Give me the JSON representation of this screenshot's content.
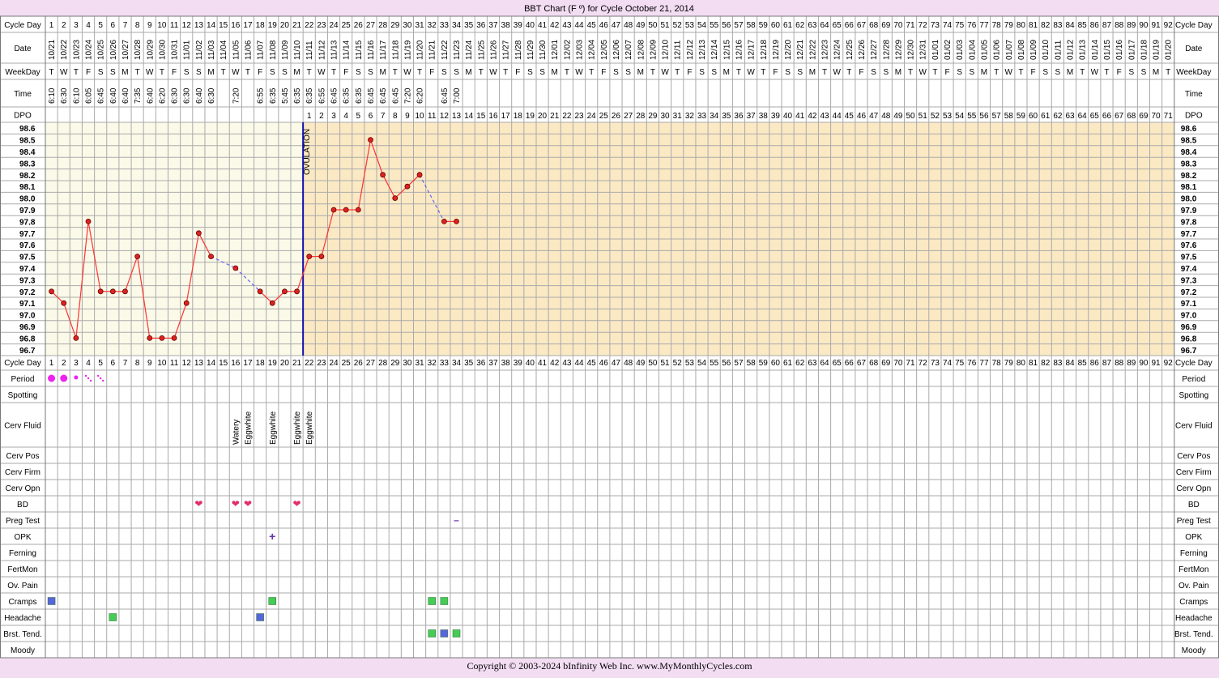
{
  "title": "BBT Chart (F º) for Cycle October 21, 2014",
  "copyright": "Copyright © 2003-2024 bInfinity Web Inc.     www.MyMonthlyCycles.com",
  "colors": {
    "page_bg": "#f3ddf3",
    "pre_ovulation_bg": "#fbf9e8",
    "post_ovulation_bg": "#fbe9c4",
    "grid": "#aaaaaa",
    "line": "#ff3333",
    "point": "#dd2222",
    "gap_line": "#6666ee",
    "ovulation_line": "#1111aa",
    "heart": "#e0306f",
    "period": "#ee22ee",
    "green_box": "#44cc55",
    "blue_box": "#5566dd"
  },
  "row_labels": {
    "cycle_day": "Cycle Day",
    "date": "Date",
    "weekday": "WeekDay",
    "time": "Time",
    "dpo": "DPO"
  },
  "ovulation_label": "OVULATION",
  "cycle_days": [
    "1",
    "2",
    "3",
    "4",
    "5",
    "6",
    "7",
    "8",
    "9",
    "10",
    "11",
    "12",
    "13",
    "14",
    "15",
    "16",
    "17",
    "18",
    "19",
    "20",
    "21",
    "22",
    "23",
    "24",
    "25",
    "26",
    "27",
    "28",
    "29",
    "30",
    "31",
    "32",
    "33",
    "34",
    "35",
    "36",
    "37",
    "38",
    "39",
    "40",
    "41",
    "42",
    "43",
    "44",
    "45",
    "46",
    "47",
    "48",
    "49",
    "50",
    "51",
    "52",
    "53",
    "54",
    "55",
    "56",
    "57",
    "58",
    "59",
    "60",
    "61",
    "62",
    "63",
    "64",
    "65",
    "66",
    "67",
    "68",
    "69",
    "70",
    "71",
    "72",
    "73",
    "74",
    "75",
    "76",
    "77",
    "78",
    "79",
    "80",
    "81",
    "82",
    "83",
    "84",
    "85",
    "86",
    "87",
    "88",
    "89",
    "90",
    "91",
    "92"
  ],
  "dates": [
    "10/21",
    "10/22",
    "10/23",
    "10/24",
    "10/25",
    "10/26",
    "10/27",
    "10/28",
    "10/29",
    "10/30",
    "10/31",
    "11/01",
    "11/02",
    "11/03",
    "11/04",
    "11/05",
    "11/06",
    "11/07",
    "11/08",
    "11/09",
    "11/10",
    "11/11",
    "11/12",
    "11/13",
    "11/14",
    "11/15",
    "11/16",
    "11/17",
    "11/18",
    "11/19",
    "11/20",
    "11/21",
    "11/22",
    "11/23",
    "11/24",
    "11/25",
    "11/26",
    "11/27",
    "11/28",
    "11/29",
    "11/30",
    "12/01",
    "12/02",
    "12/03",
    "12/04",
    "12/05",
    "12/06",
    "12/07",
    "12/08",
    "12/09",
    "12/10",
    "12/11",
    "12/12",
    "12/13",
    "12/14",
    "12/15",
    "12/16",
    "12/17",
    "12/18",
    "12/19",
    "12/20",
    "12/21",
    "12/22",
    "12/23",
    "12/24",
    "12/25",
    "12/26",
    "12/27",
    "12/28",
    "12/29",
    "12/30",
    "12/31",
    "01/01",
    "01/02",
    "01/03",
    "01/04",
    "01/05",
    "01/06",
    "01/07",
    "01/08",
    "01/09",
    "01/10",
    "01/11",
    "01/12",
    "01/13",
    "01/14",
    "01/15",
    "01/16",
    "01/17",
    "01/18",
    "01/19",
    "01/20"
  ],
  "weekdays": [
    "T",
    "W",
    "T",
    "F",
    "S",
    "S",
    "M",
    "T",
    "W",
    "T",
    "F",
    "S",
    "S",
    "M",
    "T",
    "W",
    "T",
    "F",
    "S",
    "S",
    "M",
    "T",
    "W",
    "T",
    "F",
    "S",
    "S",
    "M",
    "T",
    "W",
    "T",
    "F",
    "S",
    "S",
    "M",
    "T",
    "W",
    "T",
    "F",
    "S",
    "S",
    "M",
    "T",
    "W",
    "T",
    "F",
    "S",
    "S",
    "M",
    "T",
    "W",
    "T",
    "F",
    "S",
    "S",
    "M",
    "T",
    "W",
    "T",
    "F",
    "S",
    "S",
    "M",
    "T",
    "W",
    "T",
    "F",
    "S",
    "S",
    "M",
    "T",
    "W",
    "T",
    "F",
    "S",
    "S",
    "M",
    "T",
    "W",
    "T",
    "F",
    "S",
    "S",
    "M",
    "T",
    "W",
    "T",
    "F",
    "S",
    "S",
    "M",
    "T"
  ],
  "times": [
    "6:10",
    "6:30",
    "6:10",
    "6:05",
    "6:45",
    "6:40",
    "6:40",
    "7:35",
    "6:40",
    "6:20",
    "6:30",
    "6:30",
    "6:40",
    "6:30",
    "",
    "7:20",
    "",
    "6:55",
    "6:35",
    "5:45",
    "6:35",
    "6:35",
    "6:55",
    "6:45",
    "6:35",
    "6:35",
    "6:45",
    "6:45",
    "6:45",
    "7:20",
    "6:20",
    "",
    "6:45",
    "7:00"
  ],
  "dpo_start_day": 22,
  "dpo_count": 71,
  "temp_axis": {
    "labels": [
      "98.6",
      "98.5",
      "98.4",
      "98.3",
      "98.2",
      "98.1",
      "98.0",
      "97.9",
      "97.8",
      "97.7",
      "97.6",
      "97.5",
      "97.4",
      "97.3",
      "97.2",
      "97.1",
      "97.0",
      "96.9",
      "96.8",
      "96.7"
    ],
    "max": 98.6,
    "min": 96.7
  },
  "chart_data": {
    "type": "line",
    "title": "BBT Chart (F º) for Cycle October 21, 2014",
    "xlabel": "Cycle Day",
    "ylabel": "",
    "ylim": [
      96.7,
      98.6
    ],
    "ovulation_day": 21,
    "series": [
      {
        "x": [
          1,
          2,
          3,
          4,
          5,
          6,
          7,
          8,
          9,
          10,
          11,
          12,
          13,
          14,
          16,
          18,
          19,
          20,
          21,
          22,
          23,
          24,
          25,
          26,
          27,
          28,
          29,
          30,
          31,
          33,
          34
        ],
        "values": [
          97.2,
          97.1,
          96.8,
          97.8,
          97.2,
          97.2,
          97.2,
          97.5,
          96.8,
          96.8,
          96.8,
          97.1,
          97.7,
          97.5,
          97.4,
          97.2,
          97.1,
          97.2,
          97.2,
          97.5,
          97.5,
          97.9,
          97.9,
          97.9,
          98.5,
          98.2,
          98.0,
          98.1,
          98.2,
          97.8,
          97.8
        ]
      }
    ],
    "dashed_gaps": [
      [
        14,
        16
      ],
      [
        16,
        18
      ],
      [
        31,
        33
      ]
    ]
  },
  "observations": {
    "rows": [
      "Period",
      "Spotting",
      "Cerv Fluid",
      "Cerv Pos",
      "Cerv Firm",
      "Cerv Opn",
      "BD",
      "Preg Test",
      "OPK",
      "Ferning",
      "FertMon",
      "Ov. Pain",
      "Cramps",
      "Headache",
      "Brst. Tend.",
      "Moody"
    ],
    "period": [
      {
        "day": 1,
        "level": "heavy"
      },
      {
        "day": 2,
        "level": "heavy"
      },
      {
        "day": 3,
        "level": "medium"
      },
      {
        "day": 4,
        "level": "spotty"
      },
      {
        "day": 5,
        "level": "spotty"
      }
    ],
    "cerv_fluid": [
      {
        "day": 16,
        "text": "Watery"
      },
      {
        "day": 17,
        "text": "Eggwhite"
      },
      {
        "day": 19,
        "text": "Eggwhite"
      },
      {
        "day": 21,
        "text": "Eggwhite"
      },
      {
        "day": 22,
        "text": "Eggwhite"
      }
    ],
    "bd_days": [
      13,
      16,
      17,
      21
    ],
    "bd_symbol": "❤",
    "preg_test": [
      {
        "day": 34,
        "symbol": "–"
      }
    ],
    "opk": [
      {
        "day": 19,
        "symbol": "+"
      }
    ],
    "cramps": [
      {
        "day": 1,
        "color": "blue"
      },
      {
        "day": 19,
        "color": "green"
      },
      {
        "day": 32,
        "color": "green"
      },
      {
        "day": 33,
        "color": "green"
      }
    ],
    "headache": [
      {
        "day": 6,
        "color": "green"
      },
      {
        "day": 18,
        "color": "blue"
      }
    ],
    "breast_tenderness": [
      {
        "day": 32,
        "color": "green"
      },
      {
        "day": 33,
        "color": "blue"
      },
      {
        "day": 34,
        "color": "green"
      }
    ]
  }
}
